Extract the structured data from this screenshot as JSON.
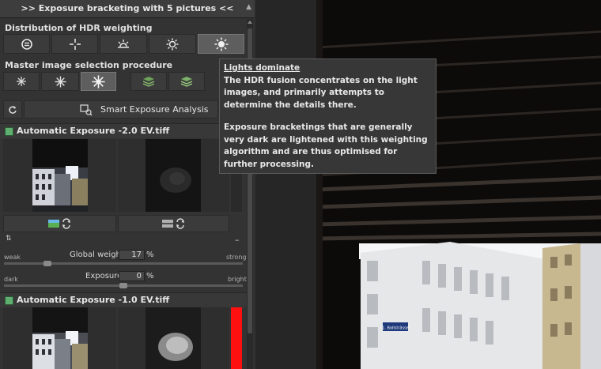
{
  "panel": {
    "title": ">> Exposure bracketing with 5 pictures <<",
    "hdr_label": "Distribution of HDR weighting",
    "master_label": "Master image selection procedure",
    "smart_label": "Smart Exposure Analysis",
    "files": [
      {
        "name": "Automatic Exposure -2.0 EV.tiff"
      },
      {
        "name": "Automatic Exposure -1.0 EV.tiff"
      }
    ],
    "global_weight": {
      "label": "Global weight",
      "value": "17",
      "unit": "%",
      "min": "weak",
      "max": "strong",
      "level": 0.17
    },
    "exposure": {
      "label": "Exposure",
      "value": "0",
      "unit": "%",
      "min": "dark",
      "max": "bright",
      "level": 0.5
    }
  },
  "tooltip": {
    "title": "Lights dominate",
    "p1": "The HDR fusion concentrates on the light images, and primarily attempts to determine the details there.",
    "p2": "Exposure bracketings that are generally very dark are lightened with this weighting algorithm and are thus optimised for further processing."
  },
  "photo": {
    "sign": "1. Bollsträsse"
  }
}
